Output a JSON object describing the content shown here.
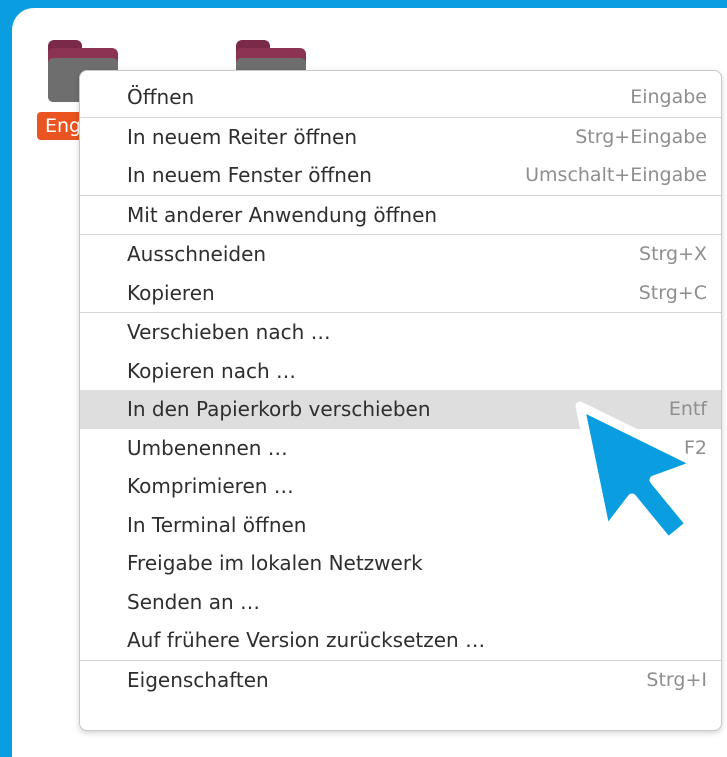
{
  "desktop": {
    "folder_label": "Eng"
  },
  "menu": {
    "items": [
      {
        "label": "Öffnen",
        "shortcut": "Eingabe"
      },
      {
        "label": "In neuem Reiter öffnen",
        "shortcut": "Strg+Eingabe"
      },
      {
        "label": "In neuem Fenster öffnen",
        "shortcut": "Umschalt+Eingabe"
      },
      {
        "label": "Mit anderer Anwendung öffnen",
        "shortcut": ""
      },
      {
        "label": "Ausschneiden",
        "shortcut": "Strg+X"
      },
      {
        "label": "Kopieren",
        "shortcut": "Strg+C"
      },
      {
        "label": "Verschieben nach …",
        "shortcut": ""
      },
      {
        "label": "Kopieren nach …",
        "shortcut": ""
      },
      {
        "label": "In den Papierkorb verschieben",
        "shortcut": "Entf"
      },
      {
        "label": "Umbenennen …",
        "shortcut": "F2"
      },
      {
        "label": "Komprimieren …",
        "shortcut": ""
      },
      {
        "label": "In Terminal öffnen",
        "shortcut": ""
      },
      {
        "label": "Freigabe im lokalen Netzwerk",
        "shortcut": ""
      },
      {
        "label": "Senden an …",
        "shortcut": ""
      },
      {
        "label": "Auf frühere Version zurücksetzen …",
        "shortcut": ""
      },
      {
        "label": "Eigenschaften",
        "shortcut": "Strg+I"
      }
    ]
  },
  "colors": {
    "background_accent": "#0a9de0",
    "folder_label_bg": "#e95420",
    "highlight_bg": "#dedede",
    "cursor": "#0a9de0"
  }
}
